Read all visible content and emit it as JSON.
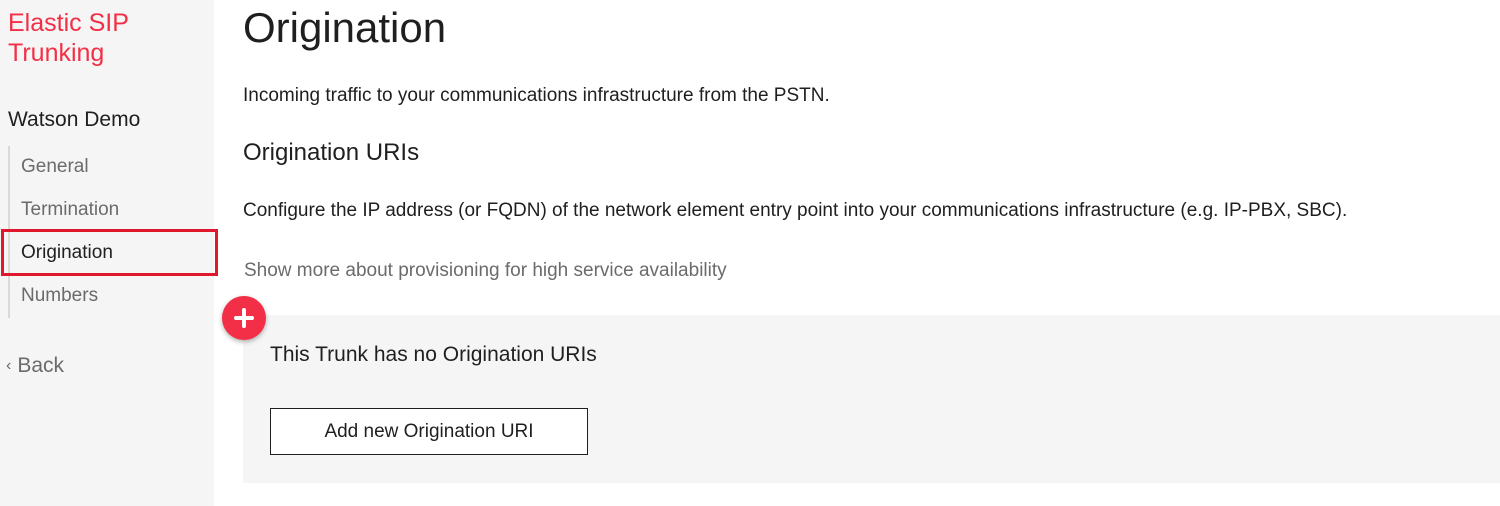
{
  "sidebar": {
    "product_title": "Elastic SIP Trunking",
    "project_name": "Watson Demo",
    "nav_items": [
      {
        "label": "General",
        "active": false
      },
      {
        "label": "Termination",
        "active": false
      },
      {
        "label": "Origination",
        "active": true
      },
      {
        "label": "Numbers",
        "active": false
      }
    ],
    "back_label": "Back"
  },
  "main": {
    "page_title": "Origination",
    "intro": "Incoming traffic to your communications infrastructure from the PSTN.",
    "section_title": "Origination URIs",
    "section_desc": "Configure the IP address (or FQDN) of the network element entry point into your communications infrastructure (e.g. IP-PBX, SBC).",
    "show_more": "Show more about provisioning for high service availability",
    "empty_state": {
      "message": "This Trunk has no Origination URIs",
      "add_button": "Add new Origination URI"
    }
  },
  "colors": {
    "accent": "#f22f46",
    "highlight": "#e0182d",
    "sidebar_bg": "#f5f5f5"
  }
}
